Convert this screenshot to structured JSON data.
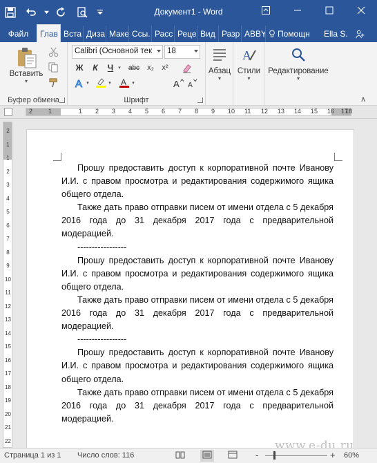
{
  "window": {
    "title": "Документ1 - Word"
  },
  "tabs": [
    "Файл",
    "Глав",
    "Вста",
    "Диза",
    "Маке",
    "Ссы.",
    "Расс",
    "Реце",
    "Вид",
    "Разр",
    "ABBY"
  ],
  "tell_me": "Помощн",
  "user": "Ella S.",
  "ribbon": {
    "clipboard": {
      "paste_label": "Вставить",
      "group_label": "Буфер обмена"
    },
    "font": {
      "name": "Calibri (Основной тек",
      "size": "18",
      "bold": "Ж",
      "italic": "К",
      "underline": "Ч",
      "strike": "abc",
      "subscript": "x₂",
      "superscript": "x²",
      "group_label": "Шрифт"
    },
    "paragraph_label": "Абзац",
    "styles_label": "Стили",
    "editing_label": "Редактирование"
  },
  "ruler": {
    "h_numbers": [
      "2",
      "1",
      "1",
      "2",
      "3",
      "4",
      "5",
      "6",
      "7",
      "8",
      "9",
      "10",
      "11",
      "12",
      "13",
      "14",
      "15",
      "16",
      "17",
      "18"
    ],
    "v_numbers": [
      "2",
      "1",
      "1",
      "2",
      "3",
      "4",
      "5",
      "6",
      "7",
      "8",
      "9",
      "10",
      "11",
      "12",
      "13",
      "14",
      "15",
      "16",
      "17",
      "18",
      "19",
      "20",
      "21",
      "22"
    ]
  },
  "document": {
    "blocks": [
      {
        "type": "para",
        "text": "Прошу предоставить доступ к корпоративной почте Иванову И.И. с правом просмотра и редактирования содержимого ящика общего отдела."
      },
      {
        "type": "para",
        "text": "Также дать право отправки писем от имени отдела с 5 декабря 2016 года до 31 декабря 2017 года с предварительной модерацией."
      },
      {
        "type": "sep",
        "text": "-----------------"
      },
      {
        "type": "para",
        "text": "Прошу предоставить доступ к корпоративной почте Иванову И.И. с правом просмотра и редактирования содержимого ящика общего отдела."
      },
      {
        "type": "para",
        "text": "Также дать право отправки писем от имени отдела с 5 декабря 2016 года до 31 декабря 2017 года с предварительной модерацией."
      },
      {
        "type": "sep",
        "text": "-----------------"
      },
      {
        "type": "para",
        "text": "Прошу предоставить доступ к корпоративной почте Иванову И.И. с правом просмотра и редактирования содержимого ящика общего отдела."
      },
      {
        "type": "para",
        "text": "Также дать право отправки писем от имени отдела с 5 декабря 2016 года до 31 декабря 2017 года с предварительной модерацией."
      }
    ]
  },
  "status": {
    "page": "Страница 1 из 1",
    "words": "Число слов: 116",
    "zoom": "60%",
    "zoom_minus": "-"
  },
  "watermark": "www.e-du.ru",
  "colors": {
    "accent": "#2b579a",
    "highlight": "#ffff00",
    "font_color": "#c00000"
  }
}
